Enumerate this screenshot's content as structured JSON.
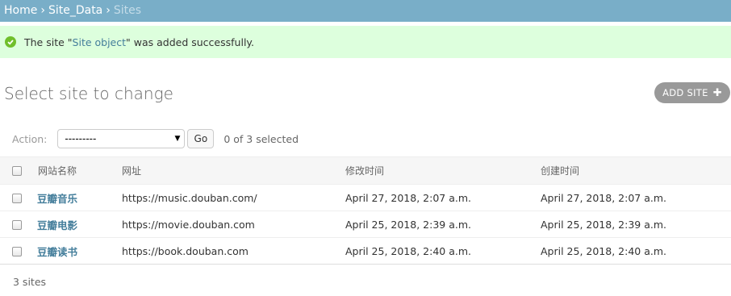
{
  "breadcrumbs": {
    "home": "Home",
    "app": "Site_Data",
    "current": "Sites",
    "separator": "›"
  },
  "message": {
    "prefix": "The site \"",
    "link": "Site object",
    "suffix": "\" was added successfully.",
    "icon": "check-circle-icon"
  },
  "page": {
    "title": "Select site to change",
    "add_button": "ADD SITE",
    "add_icon": "✚"
  },
  "actions": {
    "label": "Action:",
    "selected": "---------",
    "go": "Go",
    "count": "0 of 3 selected"
  },
  "table": {
    "columns": [
      "网站名称",
      "网址",
      "修改时间",
      "创建时间"
    ],
    "rows": [
      {
        "name": "豆瓣音乐",
        "url": "https://music.douban.com/",
        "modified": "April 27, 2018, 2:07 a.m.",
        "created": "April 27, 2018, 2:07 a.m."
      },
      {
        "name": "豆瓣电影",
        "url": "https://movie.douban.com",
        "modified": "April 25, 2018, 2:39 a.m.",
        "created": "April 25, 2018, 2:39 a.m."
      },
      {
        "name": "豆瓣读书",
        "url": "https://book.douban.com",
        "modified": "April 25, 2018, 2:40 a.m.",
        "created": "April 25, 2018, 2:40 a.m."
      }
    ]
  },
  "paginator": "3 sites",
  "colors": {
    "header_bg": "#79aec8",
    "success_bg": "#ddffdd",
    "link": "#447e9b",
    "add_button_bg": "#999999"
  }
}
